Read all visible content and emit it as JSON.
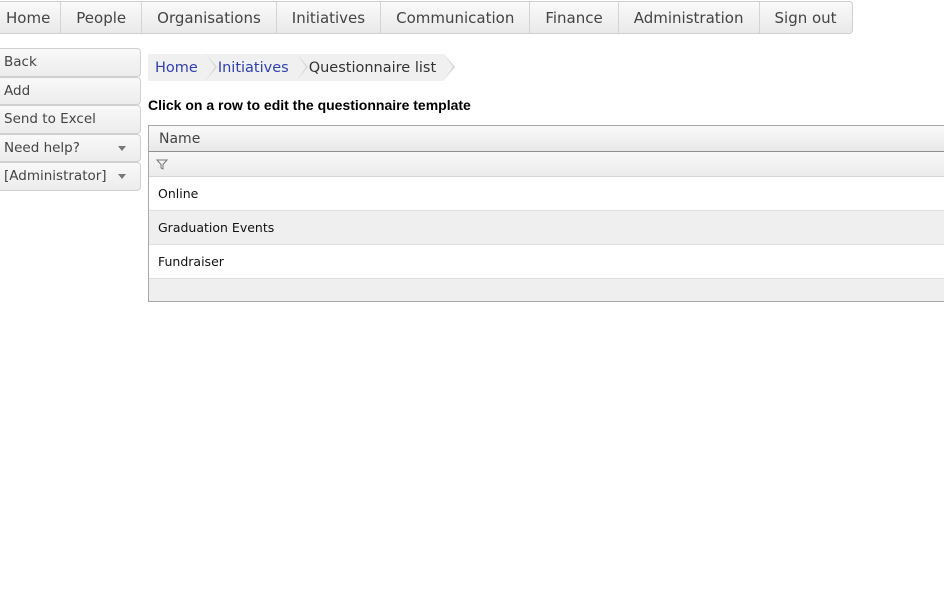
{
  "topnav": {
    "items": [
      "Home",
      "People",
      "Organisations",
      "Initiatives",
      "Communication",
      "Finance",
      "Administration",
      "Sign out"
    ]
  },
  "sidebar": {
    "items": [
      {
        "label": "Back"
      },
      {
        "label": "Add"
      },
      {
        "label": "Send to Excel"
      },
      {
        "label": "Need help?",
        "dropdown": true
      },
      {
        "label": "[Administrator]",
        "dropdown": true
      }
    ]
  },
  "breadcrumb": {
    "items": [
      "Home",
      "Initiatives",
      "Questionnaire list"
    ]
  },
  "instruction": "Click on a row to edit the questionnaire template",
  "grid": {
    "header": "Name",
    "filter_icon": "filter-icon",
    "rows": [
      "Online",
      "Graduation Events",
      "Fundraiser"
    ]
  },
  "colors": {
    "link": "#2f3fb0",
    "grid_border": "#a8a8a8",
    "row_alt": "#efefef"
  }
}
